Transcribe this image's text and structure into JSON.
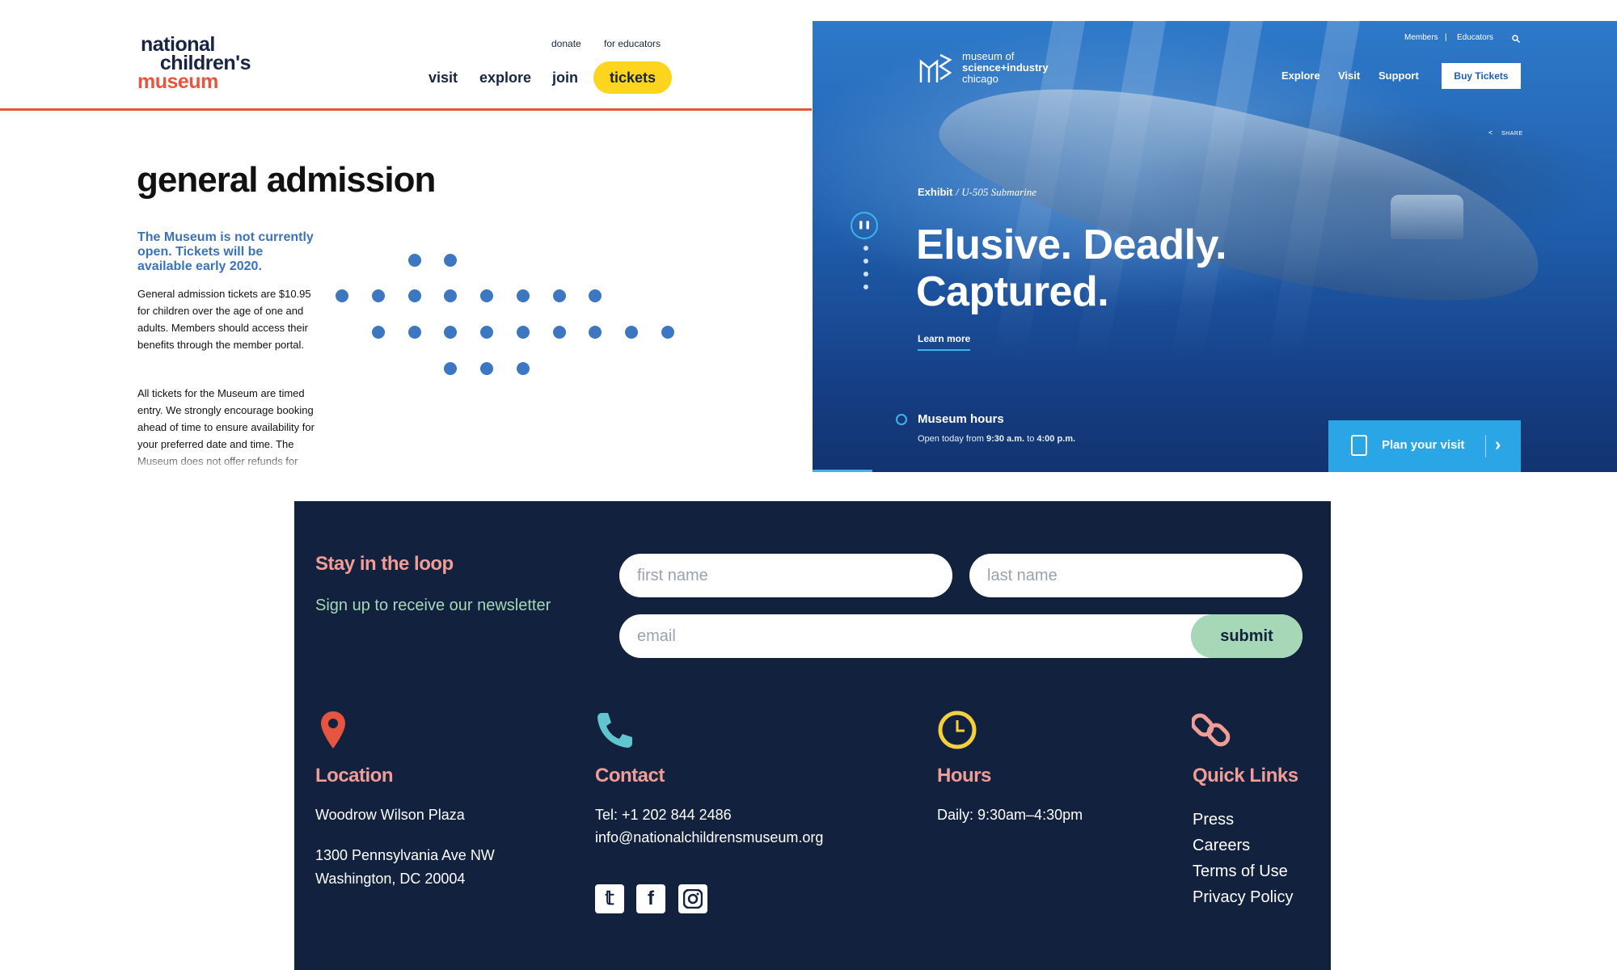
{
  "ncm": {
    "logo": {
      "line1": "national",
      "line2": "children's",
      "line3": "museum"
    },
    "util_nav": {
      "donate": "donate",
      "educators": "for educators"
    },
    "nav": {
      "visit": "visit",
      "explore": "explore",
      "join": "join",
      "tickets": "tickets"
    },
    "title": "general admission",
    "notice": "The Museum is not currently open. Tickets will be available early 2020.",
    "para1": "General admission tickets are $10.95 for children over the age of one and adults. Members should access their benefits through the member portal.",
    "para2": "All tickets for the Museum are timed entry. We strongly encourage booking ahead of time to ensure availability for your preferred date and time. The Museum does not offer refunds for purchased tickets.",
    "colors": {
      "navy": "#172442",
      "orange": "#e5553f",
      "yellow": "#fdd51f",
      "blue": "#3b73bb"
    }
  },
  "msi": {
    "logo": {
      "line1": "museum of",
      "line2": "science+industry",
      "line3": "chicago"
    },
    "util_nav": {
      "members": "Members",
      "separator": "|",
      "educators": "Educators"
    },
    "nav": {
      "explore": "Explore",
      "visit": "Visit",
      "support": "Support",
      "buy": "Buy Tickets"
    },
    "share": "SHARE",
    "exhibit_prefix": "Exhibit",
    "exhibit_sep": "/",
    "exhibit_title": "U-505 Submarine",
    "headline_line1": "Elusive. Deadly.",
    "headline_line2": "Captured.",
    "learn_more": "Learn more",
    "hours_title": "Museum hours",
    "hours_prefix": "Open today from",
    "hours_open": "9:30 a.m.",
    "hours_to": "to",
    "hours_close": "4:00 p.m.",
    "plan_visit": "Plan your visit",
    "colors": {
      "accent": "#2aa5e6"
    }
  },
  "footer": {
    "stay_title": "Stay in the loop",
    "stay_subtitle": "Sign up to receive our newsletter",
    "first_name_placeholder": "first name",
    "last_name_placeholder": "last name",
    "email_placeholder": "email",
    "submit": "submit",
    "location": {
      "title": "Location",
      "line1": "Woodrow Wilson Plaza",
      "line2": "1300 Pennsylvania Ave NW",
      "line3": "Washington, DC 20004"
    },
    "contact": {
      "title": "Contact",
      "tel": "Tel: +1 202 844 2486",
      "email": "info@nationalchildrensmuseum.org"
    },
    "hours": {
      "title": "Hours",
      "text": "Daily: 9:30am–4:30pm"
    },
    "quick_links": {
      "title": "Quick Links",
      "items": [
        "Press",
        "Careers",
        "Terms of Use",
        "Privacy Policy"
      ]
    },
    "icons": [
      "map-pin-icon",
      "phone-icon",
      "clock-icon",
      "link-icon",
      "twitter-icon",
      "facebook-icon",
      "instagram-icon"
    ],
    "colors": {
      "bg": "#12213d",
      "pink": "#ef9d96",
      "mint": "#a6d8b8"
    }
  }
}
